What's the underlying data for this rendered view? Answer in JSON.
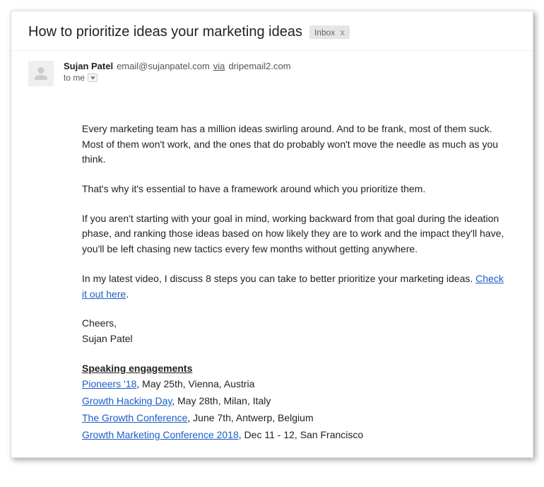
{
  "subject": "How to prioritize ideas your marketing ideas",
  "label": {
    "name": "Inbox",
    "close": "x"
  },
  "sender": {
    "name": "Sujan Patel",
    "email": "email@sujanpatel.com",
    "via_word": "via",
    "via_domain": "dripemail2.com"
  },
  "recipient": {
    "to_text": "to me"
  },
  "body": {
    "p1": "Every marketing team has a million ideas swirling around. And to be frank, most of them suck. Most of them won't work, and the ones that do probably won't move the needle as much as you think.",
    "p2": "That's why it's essential to have a framework around which you prioritize them.",
    "p3": "If you aren't starting with your goal in mind, working backward from that goal during the ideation phase, and ranking those ideas based on how likely they are to work and the impact they'll have, you'll be left chasing new tactics every few months without getting anywhere.",
    "p4_pre": "In my latest video, I discuss 8 steps you can take to better prioritize your marketing ideas. ",
    "p4_link": "Check it out here",
    "p4_post": ".",
    "cheers": "Cheers,",
    "signature_name": "Sujan Patel"
  },
  "speaking": {
    "heading": "Speaking engagements",
    "items": [
      {
        "link": "Pioneers '18",
        "rest": ", May 25th, Vienna, Austria"
      },
      {
        "link": "Growth Hacking Day",
        "rest": ", May 28th, Milan, Italy"
      },
      {
        "link": "The Growth Conference",
        "rest": ", June 7th, Antwerp, Belgium"
      },
      {
        "link": "Growth Marketing Conference 2018",
        "rest": ", Dec 11 - 12, San Francisco"
      }
    ]
  }
}
